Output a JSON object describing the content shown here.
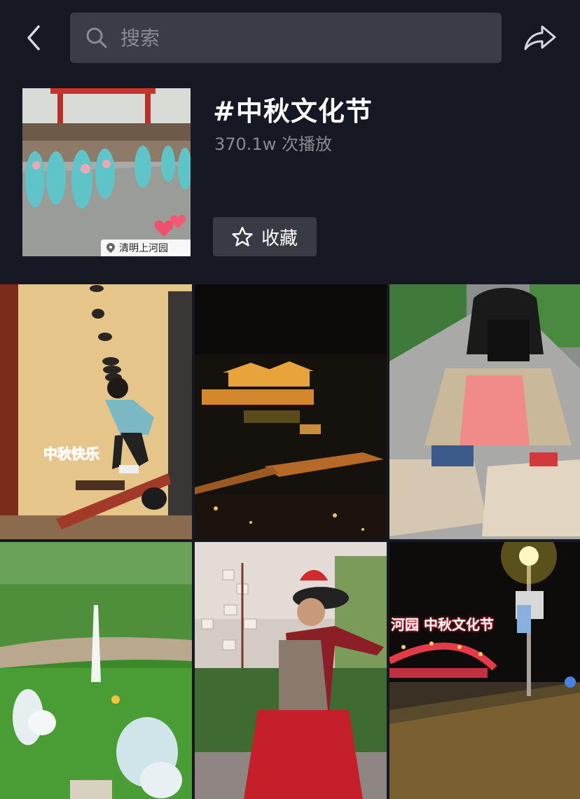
{
  "search": {
    "placeholder": "搜索"
  },
  "icons": {
    "back": "chevron-left-icon",
    "search": "magnifier-icon",
    "share": "share-arrow-icon",
    "favorite": "star-outline-icon",
    "location": "location-pin-icon"
  },
  "header": {
    "title": "#中秋文化节",
    "play_count": "370.1w 次播放",
    "favorite_label": "收藏",
    "cover_location": "清明上河园"
  },
  "videos": [
    {
      "caption": "中秋快乐"
    },
    {
      "caption": ""
    },
    {
      "caption": ""
    },
    {
      "caption": ""
    },
    {
      "caption": ""
    },
    {
      "caption": "河园  中秋文化节"
    }
  ],
  "colors": {
    "background": "#161823",
    "search_bg": "#3a3c46",
    "secondary_text": "#8a8b91",
    "button_bg": "#393b44"
  }
}
